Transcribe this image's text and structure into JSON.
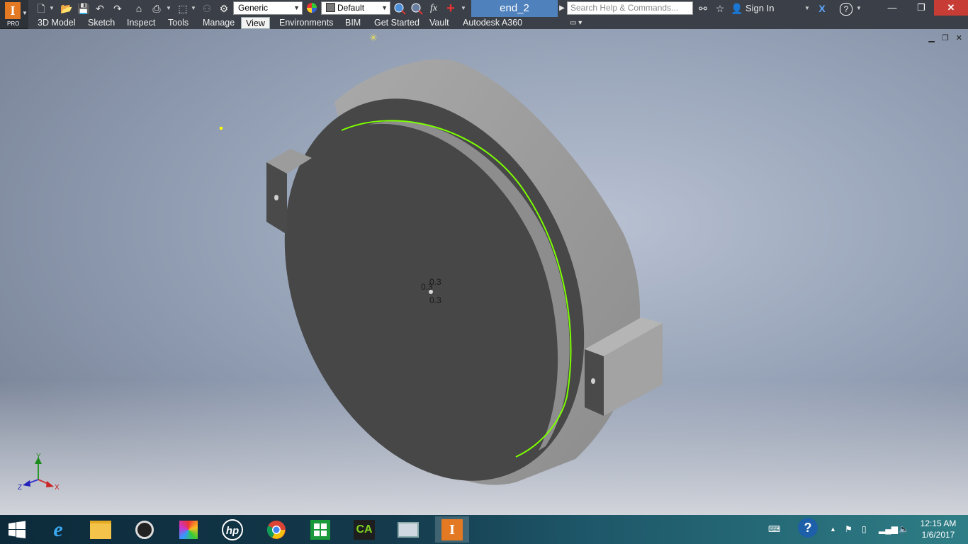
{
  "app": {
    "badge_letter": "I",
    "edition": "PRO",
    "document_title": "end_2"
  },
  "quick_access": {
    "appearance_dropdown": "Generic",
    "material_dropdown": "Default",
    "fx_label": "fx"
  },
  "search": {
    "placeholder": "Search Help & Commands..."
  },
  "account": {
    "sign_in_label": "Sign In"
  },
  "ribbon_tabs": [
    {
      "label": "3D Model"
    },
    {
      "label": "Sketch"
    },
    {
      "label": "Inspect"
    },
    {
      "label": "Tools"
    },
    {
      "label": "Manage"
    },
    {
      "label": "View",
      "active": true
    },
    {
      "label": "Environments"
    },
    {
      "label": "BIM"
    },
    {
      "label": "Get Started"
    },
    {
      "label": "Vault"
    },
    {
      "label": "Autodesk A360"
    }
  ],
  "viewport": {
    "dimension_labels": [
      "0.3",
      "0.3",
      "0.3"
    ],
    "triad_axes": {
      "x": "X",
      "y": "Y",
      "z": "Z"
    },
    "accent_colors": {
      "highlight_edge": "#7cff00",
      "model_body": "#474747"
    }
  },
  "taskbar": {
    "apps": [
      {
        "name": "start-button",
        "icon": "windows-logo"
      },
      {
        "name": "internet-explorer",
        "icon": "ie-icon"
      },
      {
        "name": "file-explorer",
        "icon": "folder-icon"
      },
      {
        "name": "webcam",
        "icon": "webcam-icon"
      },
      {
        "name": "puzzle-app",
        "icon": "puzzle-icon"
      },
      {
        "name": "hp",
        "icon": "hp-icon"
      },
      {
        "name": "chrome",
        "icon": "chrome-icon"
      },
      {
        "name": "store",
        "icon": "store-icon"
      },
      {
        "name": "camtasia",
        "icon": "camtasia-icon"
      },
      {
        "name": "task-manager",
        "icon": "monitor-icon"
      },
      {
        "name": "inventor",
        "icon": "inventor-icon",
        "active": true
      }
    ],
    "clock": {
      "time": "12:15 AM",
      "date": "1/6/2017"
    }
  }
}
